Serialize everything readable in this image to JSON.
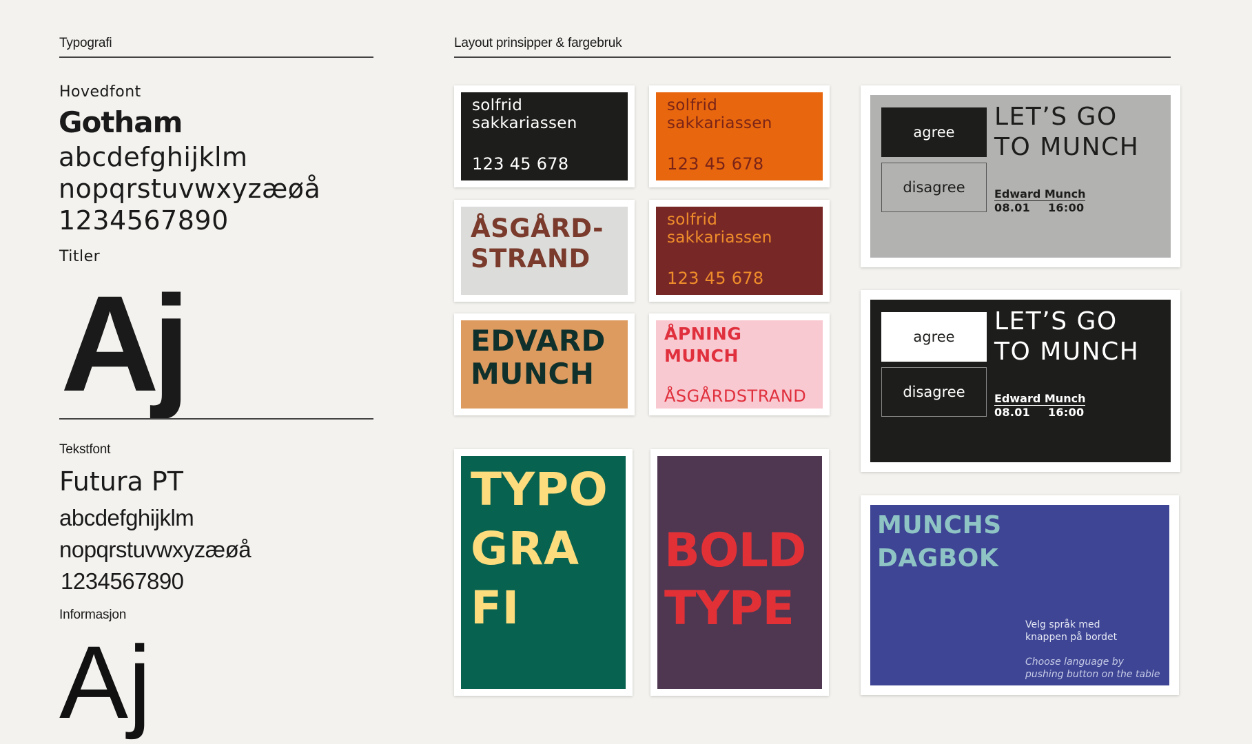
{
  "left": {
    "section_title": "Typografi",
    "main_font_label": "Hovedfont",
    "main_font_name": "Gotham",
    "main_font_line1": "abcdefghijklm",
    "main_font_line2": "nopqrstuvwxyzæøå",
    "main_font_line3": "1234567890",
    "titles_label": "Titler",
    "titles_sample": "Aj",
    "text_font_label": "Tekstfont",
    "text_font_name": "Futura PT",
    "text_font_line1": "abcdefghijklm",
    "text_font_line2": "nopqrstuvwxyzæøå",
    "text_font_line3": "1234567890",
    "info_label": "Informasjon",
    "info_sample": "Aj"
  },
  "right": {
    "section_title": "Layout prinsipper & fargebruk"
  },
  "cards": {
    "c1": {
      "name": "solfrid\nsakkariassen",
      "number": "123 45 678",
      "bg": "#1d1d1b",
      "fg": "#ffffff"
    },
    "c2": {
      "name": "solfrid\nsakkariassen",
      "number": "123 45 678",
      "bg": "#e8660d",
      "fg": "#7a2418"
    },
    "c3": {
      "text": "ÅSGÅRD-\nSTRAND",
      "bg": "#dcdddb",
      "fg": "#7a3a2c"
    },
    "c4": {
      "name": "solfrid\nsakkariassen",
      "number": "123 45 678",
      "bg": "#782727",
      "fg": "#ef8d2a"
    },
    "c5": {
      "text": "EDVARD\nMUNCH",
      "bg": "#dd9b60",
      "fg": "#10302b"
    },
    "c6": {
      "title": "ÅPNING\nMUNCH",
      "sub": "ÅSGÅRDSTRAND",
      "bg": "#f8c9d1",
      "fg": "#e0303d"
    },
    "c7": {
      "text": "TYPO\nGRA\nFI",
      "bg": "#076350",
      "fg": "#fddc7d"
    },
    "c8": {
      "text": "BOLD\nTYPE",
      "bg": "#4f3752",
      "fg": "#e13137"
    }
  },
  "screen_light": {
    "agree": "agree",
    "disagree": "disagree",
    "title": "LET’S GO\nTO MUNCH",
    "event_name": "Edward Munch",
    "date": "08.01",
    "time": "16:00",
    "bg": "#b2b2b1"
  },
  "screen_dark": {
    "agree": "agree",
    "disagree": "disagree",
    "title": "LET’S GO\nTO MUNCH",
    "event_name": "Edward Munch",
    "date": "08.01",
    "time": "16:00",
    "bg": "#1d1d1b"
  },
  "screen_blue": {
    "title": "MUNCHS\nDAGBOK",
    "no_text": "Velg språk med\nknappen på bordet",
    "en_text": "Choose language by\npushing button on the table",
    "bg": "#3d4594",
    "title_color": "#8fc4c5"
  }
}
